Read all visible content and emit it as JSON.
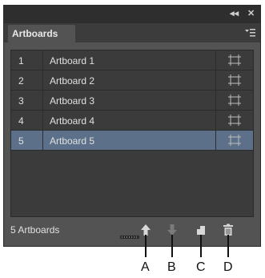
{
  "panel": {
    "tab_label": "Artboards",
    "collapse_icon": "double-chevron-left-icon",
    "close_icon": "close-icon",
    "menu_icon": "panel-menu-icon",
    "collapse_label": "◂◂",
    "close_label": "✕"
  },
  "artboards": [
    {
      "num": "1",
      "name": "Artboard 1",
      "selected": false
    },
    {
      "num": "2",
      "name": "Artboard 2",
      "selected": false
    },
    {
      "num": "3",
      "name": "Artboard 3",
      "selected": false
    },
    {
      "num": "4",
      "name": "Artboard 4",
      "selected": false
    },
    {
      "num": "5",
      "name": "Artboard 5",
      "selected": true
    }
  ],
  "status": {
    "count_label": "5 Artboards"
  },
  "buttons": [
    {
      "name": "move-up-button",
      "icon": "arrow-up-icon"
    },
    {
      "name": "move-down-button",
      "icon": "arrow-down-icon"
    },
    {
      "name": "new-artboard-button",
      "icon": "new-artboard-icon"
    },
    {
      "name": "delete-artboard-button",
      "icon": "trash-icon"
    }
  ],
  "callouts": {
    "a": "A",
    "b": "B",
    "c": "C",
    "d": "D"
  },
  "colors": {
    "selected_row": "#5c7189",
    "panel_bg": "#535353"
  }
}
